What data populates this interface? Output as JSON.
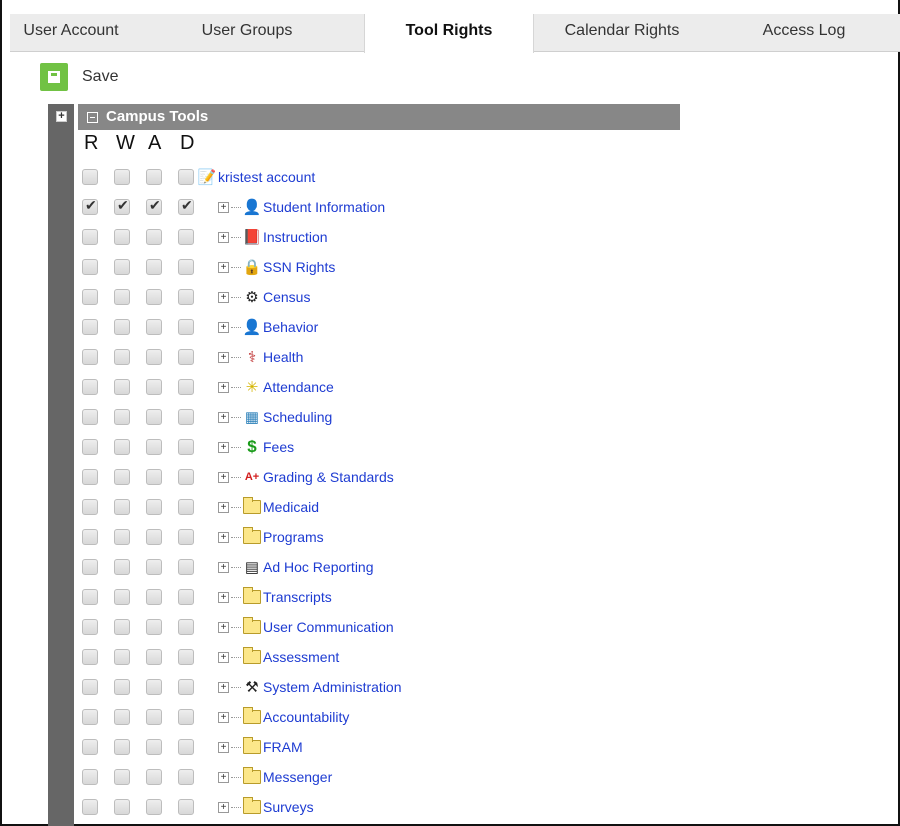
{
  "tabs": [
    {
      "label": "User Account"
    },
    {
      "label": "User Groups"
    },
    {
      "label": "Tool Rights",
      "active": true
    },
    {
      "label": "Calendar Rights"
    },
    {
      "label": "Access Log"
    }
  ],
  "toolbar": {
    "save_label": "Save"
  },
  "section": {
    "title": "Campus Tools"
  },
  "columns": [
    "R",
    "W",
    "A",
    "D"
  ],
  "tools": [
    {
      "label": "kristest account",
      "icon": "account-icon",
      "checked": [
        false,
        false,
        false,
        false
      ],
      "expandable": false
    },
    {
      "label": "Student Information",
      "icon": "student-icon",
      "checked": [
        true,
        true,
        true,
        true
      ],
      "expandable": true
    },
    {
      "label": "Instruction",
      "icon": "instruction-icon",
      "checked": [
        false,
        false,
        false,
        false
      ],
      "expandable": true
    },
    {
      "label": "SSN Rights",
      "icon": "lock-icon",
      "checked": [
        false,
        false,
        false,
        false
      ],
      "expandable": true
    },
    {
      "label": "Census",
      "icon": "census-icon",
      "checked": [
        false,
        false,
        false,
        false
      ],
      "expandable": true
    },
    {
      "label": "Behavior",
      "icon": "behavior-icon",
      "checked": [
        false,
        false,
        false,
        false
      ],
      "expandable": true
    },
    {
      "label": "Health",
      "icon": "caduceus-icon",
      "checked": [
        false,
        false,
        false,
        false
      ],
      "expandable": true
    },
    {
      "label": "Attendance",
      "icon": "attendance-icon",
      "checked": [
        false,
        false,
        false,
        false
      ],
      "expandable": true
    },
    {
      "label": "Scheduling",
      "icon": "scheduling-icon",
      "checked": [
        false,
        false,
        false,
        false
      ],
      "expandable": true
    },
    {
      "label": "Fees",
      "icon": "dollar-icon",
      "checked": [
        false,
        false,
        false,
        false
      ],
      "expandable": true
    },
    {
      "label": "Grading & Standards",
      "icon": "grade-icon",
      "checked": [
        false,
        false,
        false,
        false
      ],
      "expandable": true
    },
    {
      "label": "Medicaid",
      "icon": "folder-icon",
      "checked": [
        false,
        false,
        false,
        false
      ],
      "expandable": true
    },
    {
      "label": "Programs",
      "icon": "folder-icon",
      "checked": [
        false,
        false,
        false,
        false
      ],
      "expandable": true
    },
    {
      "label": "Ad Hoc Reporting",
      "icon": "reporting-icon",
      "checked": [
        false,
        false,
        false,
        false
      ],
      "expandable": true
    },
    {
      "label": "Transcripts",
      "icon": "folder-icon",
      "checked": [
        false,
        false,
        false,
        false
      ],
      "expandable": true
    },
    {
      "label": "User Communication",
      "icon": "folder-icon",
      "checked": [
        false,
        false,
        false,
        false
      ],
      "expandable": true
    },
    {
      "label": "Assessment",
      "icon": "folder-icon",
      "checked": [
        false,
        false,
        false,
        false
      ],
      "expandable": true
    },
    {
      "label": "System Administration",
      "icon": "tools-icon",
      "checked": [
        false,
        false,
        false,
        false
      ],
      "expandable": true
    },
    {
      "label": "Accountability",
      "icon": "folder-icon",
      "checked": [
        false,
        false,
        false,
        false
      ],
      "expandable": true
    },
    {
      "label": "FRAM",
      "icon": "folder-icon",
      "checked": [
        false,
        false,
        false,
        false
      ],
      "expandable": true
    },
    {
      "label": "Messenger",
      "icon": "folder-icon",
      "checked": [
        false,
        false,
        false,
        false
      ],
      "expandable": true
    },
    {
      "label": "Surveys",
      "icon": "folder-icon",
      "checked": [
        false,
        false,
        false,
        false
      ],
      "expandable": true
    }
  ]
}
